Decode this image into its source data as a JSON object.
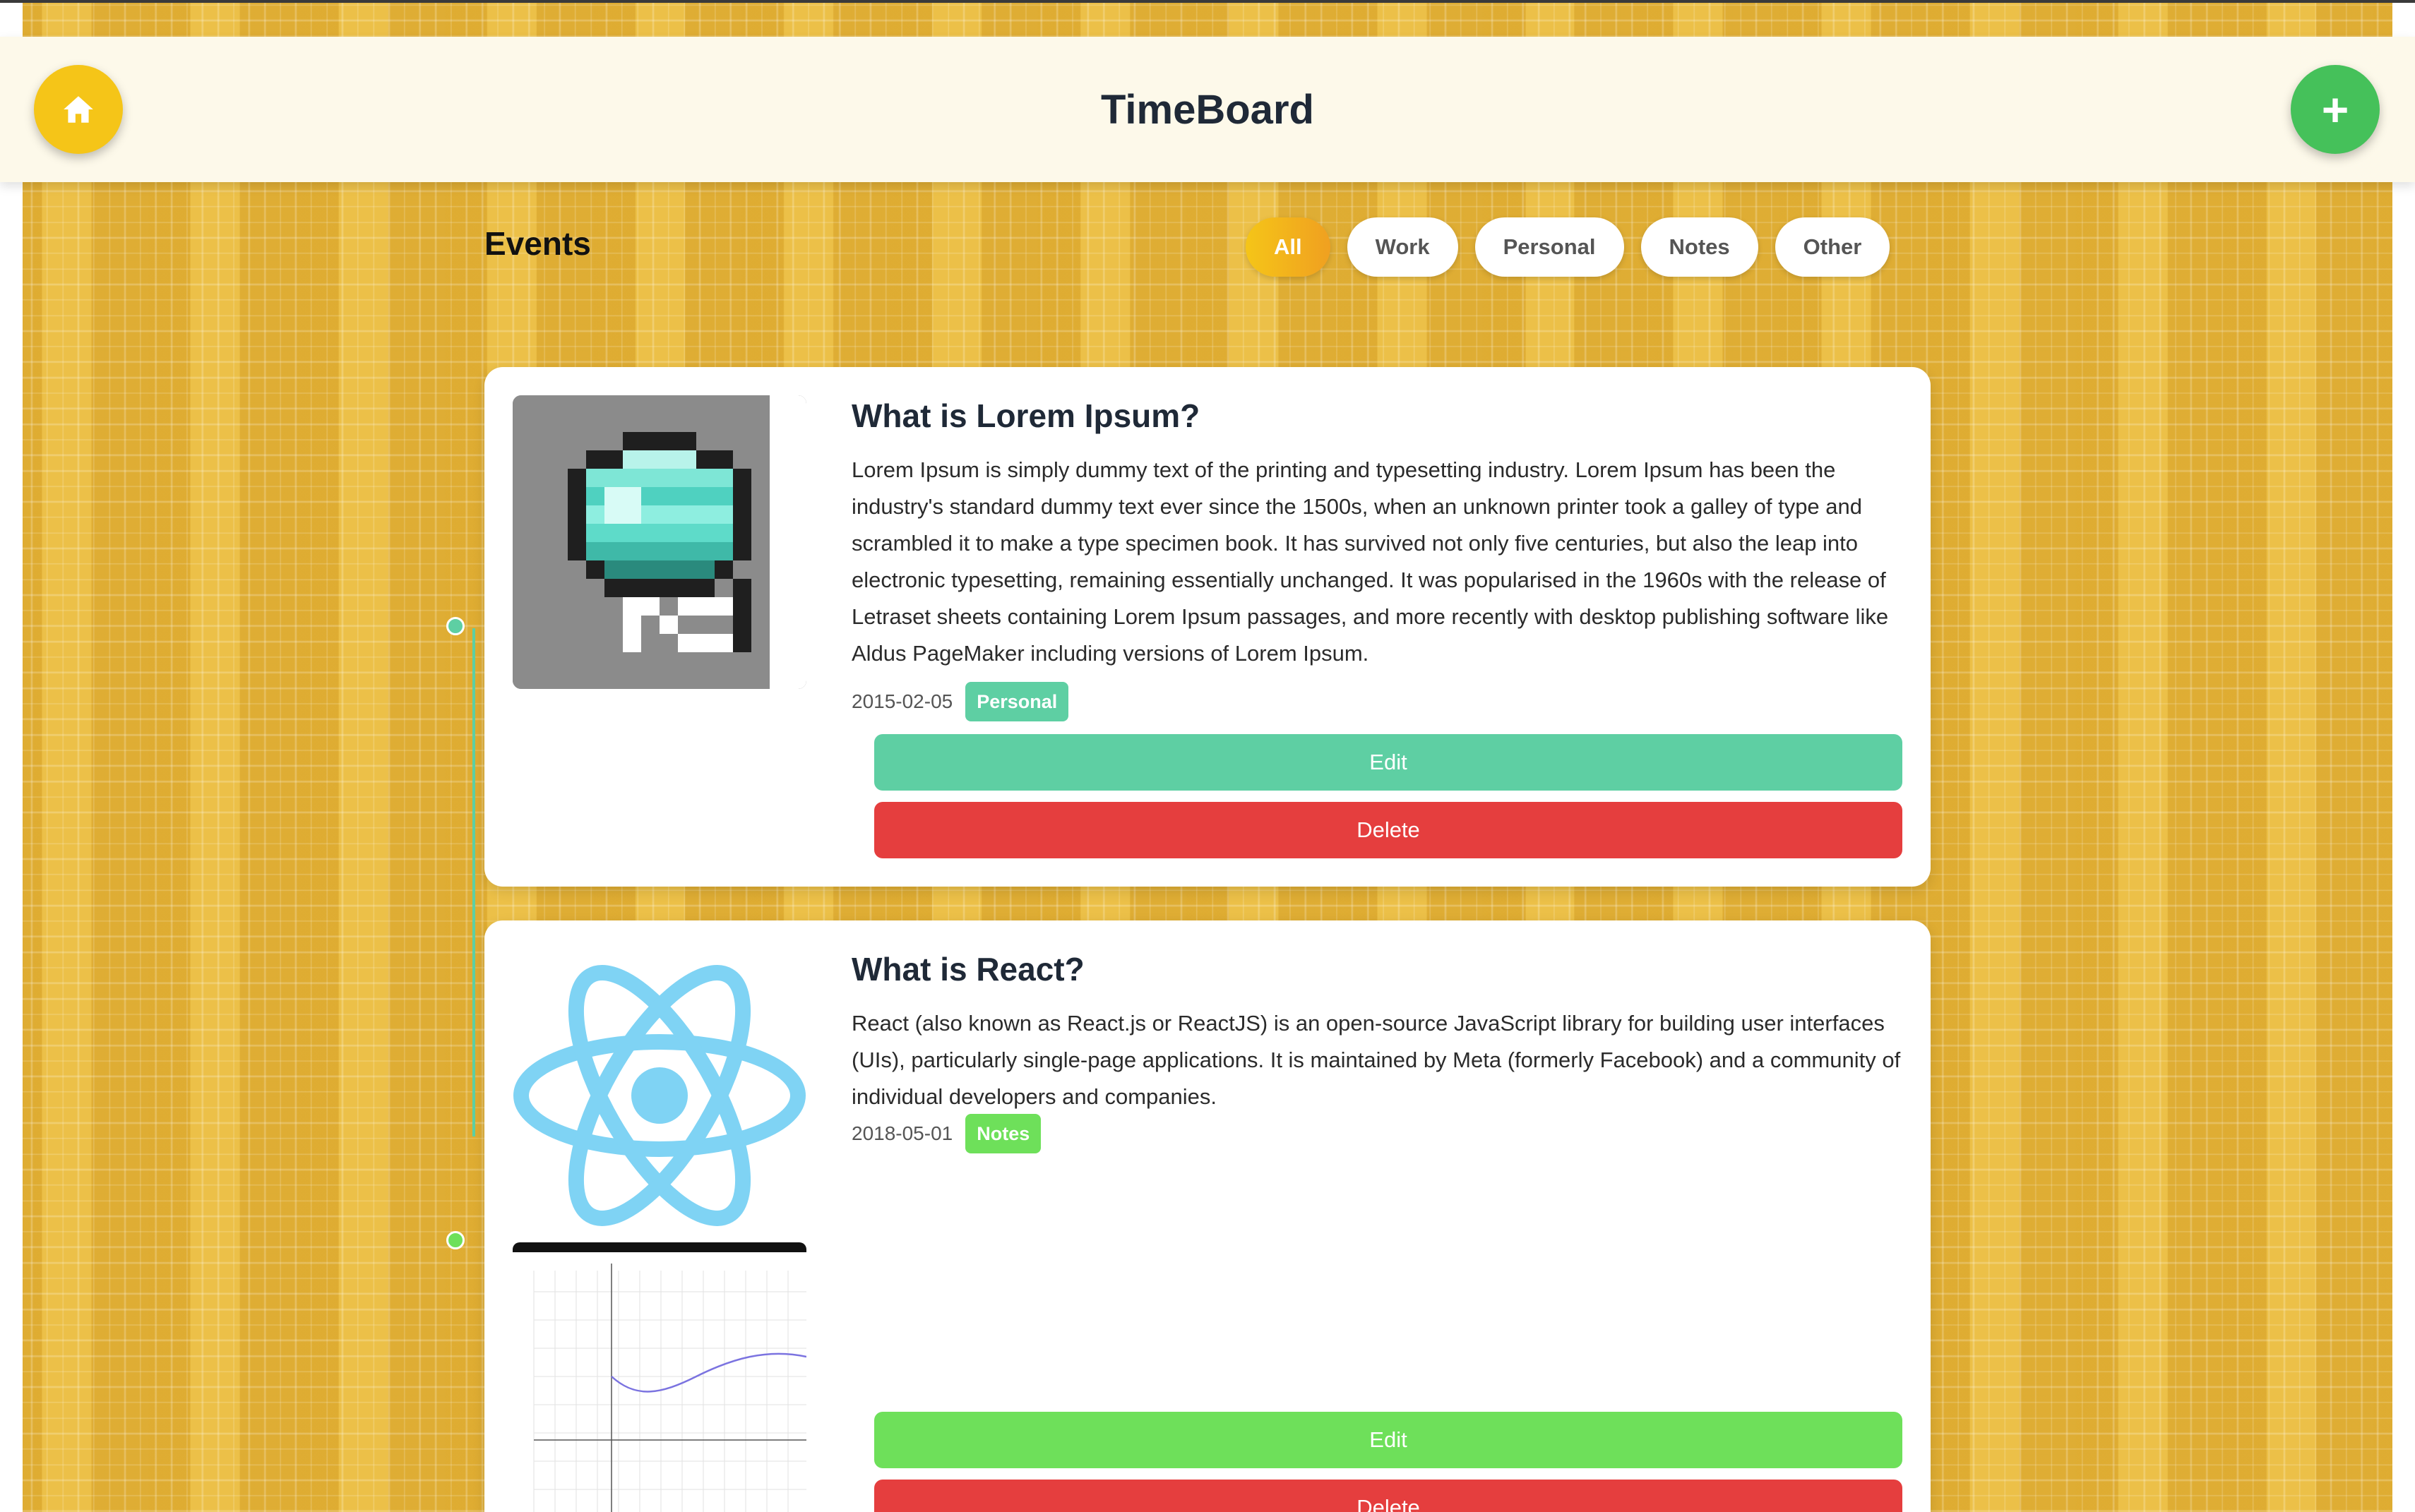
{
  "header": {
    "title": "TimeBoard",
    "add_label": "+"
  },
  "events": {
    "heading": "Events",
    "filters": [
      {
        "label": "All",
        "active": true
      },
      {
        "label": "Work",
        "active": false
      },
      {
        "label": "Personal",
        "active": false
      },
      {
        "label": "Notes",
        "active": false
      },
      {
        "label": "Other",
        "active": false
      }
    ]
  },
  "cards": [
    {
      "title": "What is Lorem Ipsum?",
      "body": "Lorem Ipsum is simply dummy text of the printing and typesetting industry. Lorem Ipsum has been the industry's standard dummy text ever since the 1500s, when an unknown printer took a galley of type and scrambled it to make a type specimen book. It has survived not only five centuries, but also the leap into electronic typesetting, remaining essentially unchanged. It was popularised in the 1960s with the release of Letraset sheets containing Lorem Ipsum passages, and more recently with desktop publishing software like Aldus PageMaker including versions of Lorem Ipsum.",
      "date": "2015-02-05",
      "category": "Personal",
      "category_color": "#5ecfa3",
      "edit_label": "Edit",
      "edit_color": "#5ecfa3",
      "delete_label": "Delete",
      "delete_color": "#e53e3e",
      "image_icon": "diamond-pixel-icon"
    },
    {
      "title": "What is React?",
      "body": "React (also known as React.js or ReactJS) is an open-source JavaScript library for building user interfaces (UIs), particularly single-page applications. It is maintained by Meta (formerly Facebook) and a community of individual developers and companies.",
      "date": "2018-05-01",
      "category": "Notes",
      "category_color": "#6ee05a",
      "edit_label": "Edit",
      "edit_color": "#6ee05a",
      "delete_label": "Delete",
      "delete_color": "#e53e3e",
      "image_icon": "react-logo-icon",
      "secondary_image_icon": "graph-screenshot-icon"
    }
  ],
  "colors": {
    "home_button": "#f5c518",
    "add_button": "#45c15a",
    "header_bg": "#fdf9ea",
    "background": "#e8b839"
  }
}
